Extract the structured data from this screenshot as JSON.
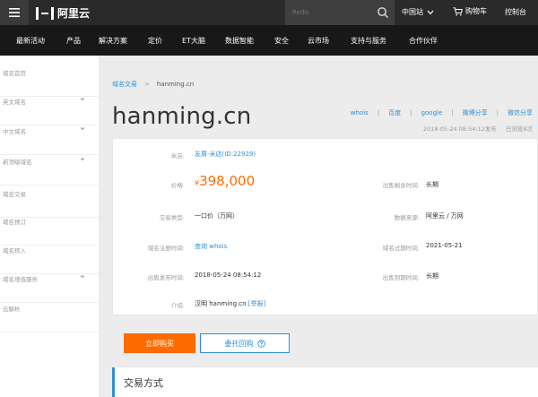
{
  "topbar": {
    "logo_text": "阿里云",
    "search_placeholder": "Redis",
    "site": "中国站",
    "cart": "购物车",
    "console": "控制台"
  },
  "nav": [
    "最新活动",
    "产品",
    "解决方案",
    "定价",
    "ET大脑",
    "数据智能",
    "安全",
    "云市场",
    "支持与服务",
    "合作伙伴"
  ],
  "sidebar": {
    "items": [
      {
        "label": "域名首页",
        "expandable": false
      },
      {
        "label": "英文域名",
        "expandable": true
      },
      {
        "label": "中文域名",
        "expandable": true
      },
      {
        "label": "新顶级域名",
        "expandable": true
      },
      {
        "label": "域名交易",
        "expandable": false
      },
      {
        "label": "域名预订",
        "expandable": false
      },
      {
        "label": "域名转入",
        "expandable": false
      },
      {
        "label": "域名增值服务",
        "expandable": true
      },
      {
        "label": "云解析",
        "expandable": false
      }
    ]
  },
  "breadcrumb": {
    "root": "域名交易",
    "separator": ">",
    "current": "hanming.cn"
  },
  "domain": "hanming.cn",
  "share": [
    "whois",
    "百度",
    "google",
    "微博分享",
    "微信分享"
  ],
  "meta": {
    "published": "2018-05-24 08:54:12发布",
    "viewed": "已浏览8次"
  },
  "details": {
    "seller_label": "米店:",
    "seller_value": "友屑-米店(ID:22929)",
    "price_label": "价格:",
    "price_symbol": "¥",
    "price_value": "398,000",
    "remaining_label": "出售剩余时间:",
    "remaining_value": "长期",
    "type_label": "交易类型:",
    "type_value": "一口价（万网）",
    "source_label": "数据来源:",
    "source_value": "阿里云 / 万网",
    "reg_label": "域名注册时间:",
    "reg_value": "查询 whois",
    "expire_label": "域名过期时间:",
    "expire_value": "2021-05-21",
    "pub_label": "出售发布时间:",
    "pub_value": "2018-05-24 08:54:12",
    "end_label": "出售到期时间:",
    "end_value": "长期",
    "intro_label": "介绍:",
    "intro_value": "汉明 hanming.cn",
    "report": "[举报]"
  },
  "buttons": {
    "buy": "立即购买",
    "broker": "委托回购"
  },
  "section_title": "交易方式",
  "colors": {
    "accent": "#ff6a00",
    "link": "#2f8fd6",
    "topbar": "#2a2a2a",
    "navbar": "#181818"
  }
}
